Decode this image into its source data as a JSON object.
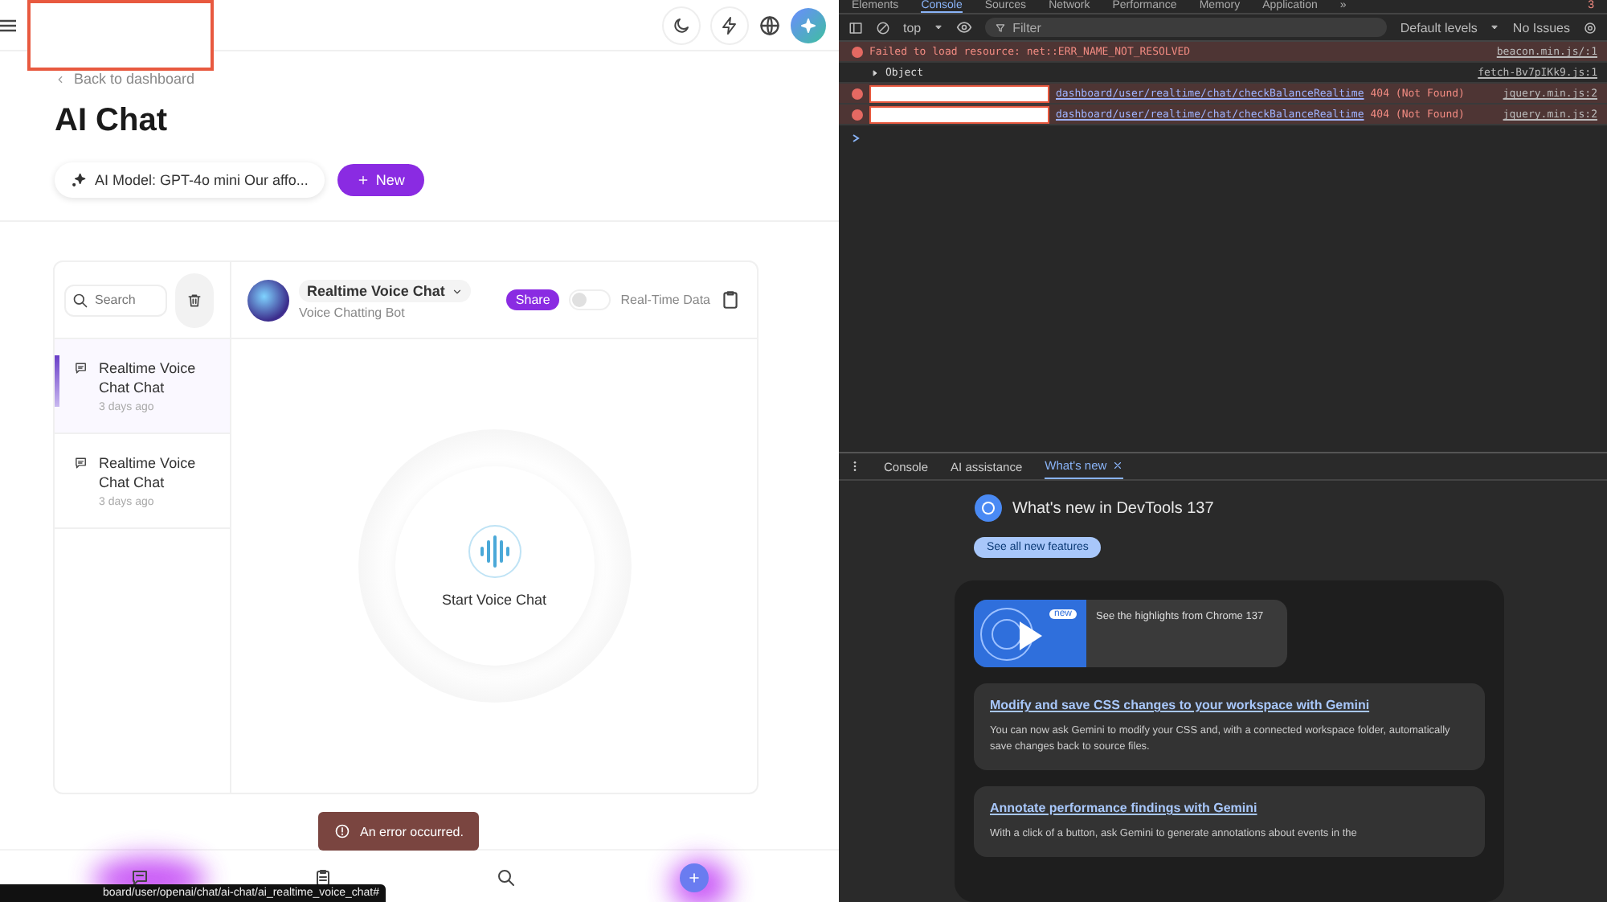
{
  "app": {
    "back_link": "Back to dashboard",
    "title": "AI Chat",
    "model_selector": "AI Model: GPT-4o mini Our affo...",
    "new_button": "New",
    "search": {
      "placeholder": "Search"
    },
    "conversations": [
      {
        "title": "Realtime Voice Chat Chat",
        "time": "3 days ago",
        "selected": true
      },
      {
        "title": "Realtime Voice Chat Chat",
        "time": "3 days ago",
        "selected": false
      }
    ],
    "bot": {
      "name": "Realtime Voice Chat",
      "subtitle": "Voice Chatting Bot"
    },
    "share_button": "Share",
    "realtime_toggle": {
      "label": "Real-Time Data",
      "on": false
    },
    "voice_button": "Start Voice Chat",
    "toast": "An error occurred.",
    "status_url": "board/user/openai/chat/ai-chat/ai_realtime_voice_chat#"
  },
  "devtools": {
    "tabs": [
      {
        "label": "Elements",
        "selected": false
      },
      {
        "label": "Console",
        "selected": true
      },
      {
        "label": "Sources",
        "selected": false
      },
      {
        "label": "Network",
        "selected": false
      },
      {
        "label": "Performance",
        "selected": false
      },
      {
        "label": "Memory",
        "selected": false
      },
      {
        "label": "Application",
        "selected": false
      }
    ],
    "overflow": "»",
    "error_count": "3",
    "context": "top",
    "filter": {
      "placeholder": "Filter"
    },
    "levels": "Default levels",
    "issues": "No Issues",
    "messages": [
      {
        "kind": "error",
        "text": "Failed to load resource: net::ERR_NAME_NOT_RESOLVED",
        "source": "beacon.min.js/:1"
      },
      {
        "kind": "object",
        "text": "Object",
        "source": "fetch-Bv7pIKk9.js:1"
      },
      {
        "kind": "redacted-error",
        "url": "dashboard/user/realtime/chat/checkBalanceRealtime",
        "status": "404 (Not Found)",
        "source": "jquery.min.js:2"
      },
      {
        "kind": "redacted-error",
        "url": "dashboard/user/realtime/chat/checkBalanceRealtime",
        "status": "404 (Not Found)",
        "source": "jquery.min.js:2"
      }
    ],
    "drawer_tabs": [
      {
        "label": "Console",
        "selected": false
      },
      {
        "label": "AI assistance",
        "selected": false
      },
      {
        "label": "What's new",
        "selected": true
      }
    ],
    "whats_new": {
      "title": "What's new in DevTools 137",
      "button": "See all new features",
      "highlight_badge": "new",
      "highlight_text": "See the highlights from Chrome 137",
      "features": [
        {
          "title": "Modify and save CSS changes to your workspace with Gemini",
          "description": "You can now ask Gemini to modify your CSS and, with a connected workspace folder, automatically save changes back to source files."
        },
        {
          "title": "Annotate performance findings with Gemini",
          "description": "With a click of a button, ask Gemini to generate annotations about events in the"
        }
      ]
    }
  }
}
